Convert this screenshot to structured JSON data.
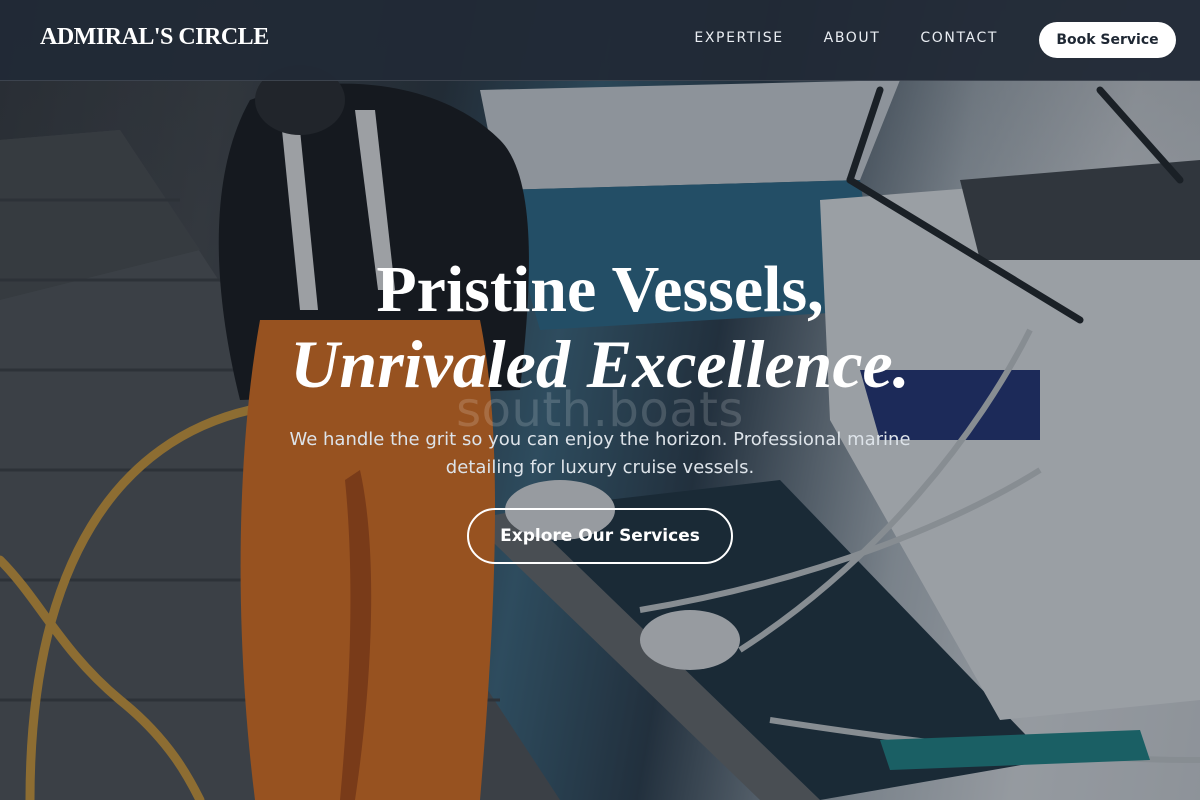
{
  "brand": {
    "logo_text": "ADMIRAL'S CIRCLE"
  },
  "nav": {
    "links": [
      {
        "label": "EXPERTISE"
      },
      {
        "label": "ABOUT"
      },
      {
        "label": "CONTACT"
      }
    ],
    "cta_label": "Book Service"
  },
  "hero": {
    "title_line1": "Pristine Vessels,",
    "title_line2": "Unrivaled Excellence.",
    "watermark": "south.boats",
    "subtitle": "We handle the grit so you can enjoy the horizon. Professional marine detailing for luxury cruise vessels.",
    "cta_label": "Explore Our Services",
    "background_icon": "marina-photo"
  },
  "colors": {
    "navbar_bg": "#212a36",
    "accent_orange": "#e8741e",
    "text_light": "#ffffff",
    "button_bg": "#ffffff",
    "button_text": "#1e2733"
  }
}
